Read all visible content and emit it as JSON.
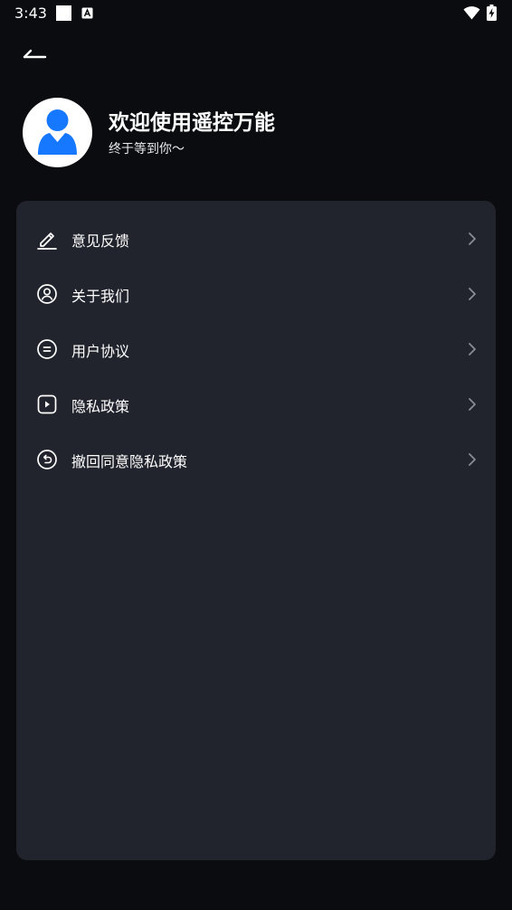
{
  "status_bar": {
    "time": "3:43",
    "icons": [
      "white-square-icon",
      "a-notification-icon",
      "wifi-icon",
      "battery-charging-icon"
    ]
  },
  "header": {
    "back_icon": "back-arrow-icon"
  },
  "profile": {
    "avatar_icon": "user-avatar-icon",
    "title": "欢迎使用遥控万能",
    "subtitle": "终于等到你～"
  },
  "menu": {
    "items": [
      {
        "label": "意见反馈",
        "icon": "pencil-icon"
      },
      {
        "label": "关于我们",
        "icon": "user-circle-icon"
      },
      {
        "label": "用户协议",
        "icon": "agreement-icon"
      },
      {
        "label": "隐私政策",
        "icon": "play-square-icon"
      },
      {
        "label": "撤回同意隐私政策",
        "icon": "undo-circle-icon"
      }
    ]
  },
  "colors": {
    "background": "#0b0c0f",
    "card": "#21242d",
    "avatar_blue": "#1677ff",
    "text": "#ffffff",
    "chevron": "#8a8d96"
  }
}
